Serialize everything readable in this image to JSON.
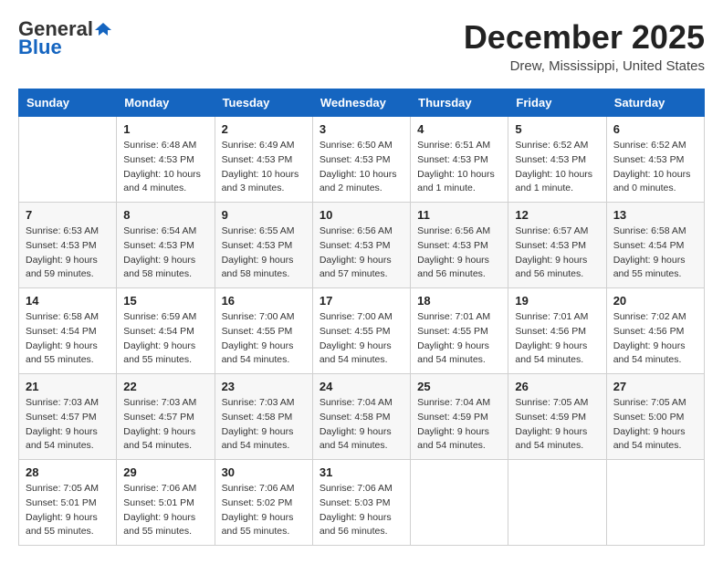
{
  "header": {
    "logo_general": "General",
    "logo_blue": "Blue",
    "month_title": "December 2025",
    "location": "Drew, Mississippi, United States"
  },
  "days_of_week": [
    "Sunday",
    "Monday",
    "Tuesday",
    "Wednesday",
    "Thursday",
    "Friday",
    "Saturday"
  ],
  "weeks": [
    [
      {
        "day": "",
        "content": ""
      },
      {
        "day": "1",
        "content": "Sunrise: 6:48 AM\nSunset: 4:53 PM\nDaylight: 10 hours\nand 4 minutes."
      },
      {
        "day": "2",
        "content": "Sunrise: 6:49 AM\nSunset: 4:53 PM\nDaylight: 10 hours\nand 3 minutes."
      },
      {
        "day": "3",
        "content": "Sunrise: 6:50 AM\nSunset: 4:53 PM\nDaylight: 10 hours\nand 2 minutes."
      },
      {
        "day": "4",
        "content": "Sunrise: 6:51 AM\nSunset: 4:53 PM\nDaylight: 10 hours\nand 1 minute."
      },
      {
        "day": "5",
        "content": "Sunrise: 6:52 AM\nSunset: 4:53 PM\nDaylight: 10 hours\nand 1 minute."
      },
      {
        "day": "6",
        "content": "Sunrise: 6:52 AM\nSunset: 4:53 PM\nDaylight: 10 hours\nand 0 minutes."
      }
    ],
    [
      {
        "day": "7",
        "content": "Sunrise: 6:53 AM\nSunset: 4:53 PM\nDaylight: 9 hours\nand 59 minutes."
      },
      {
        "day": "8",
        "content": "Sunrise: 6:54 AM\nSunset: 4:53 PM\nDaylight: 9 hours\nand 58 minutes."
      },
      {
        "day": "9",
        "content": "Sunrise: 6:55 AM\nSunset: 4:53 PM\nDaylight: 9 hours\nand 58 minutes."
      },
      {
        "day": "10",
        "content": "Sunrise: 6:56 AM\nSunset: 4:53 PM\nDaylight: 9 hours\nand 57 minutes."
      },
      {
        "day": "11",
        "content": "Sunrise: 6:56 AM\nSunset: 4:53 PM\nDaylight: 9 hours\nand 56 minutes."
      },
      {
        "day": "12",
        "content": "Sunrise: 6:57 AM\nSunset: 4:53 PM\nDaylight: 9 hours\nand 56 minutes."
      },
      {
        "day": "13",
        "content": "Sunrise: 6:58 AM\nSunset: 4:54 PM\nDaylight: 9 hours\nand 55 minutes."
      }
    ],
    [
      {
        "day": "14",
        "content": "Sunrise: 6:58 AM\nSunset: 4:54 PM\nDaylight: 9 hours\nand 55 minutes."
      },
      {
        "day": "15",
        "content": "Sunrise: 6:59 AM\nSunset: 4:54 PM\nDaylight: 9 hours\nand 55 minutes."
      },
      {
        "day": "16",
        "content": "Sunrise: 7:00 AM\nSunset: 4:55 PM\nDaylight: 9 hours\nand 54 minutes."
      },
      {
        "day": "17",
        "content": "Sunrise: 7:00 AM\nSunset: 4:55 PM\nDaylight: 9 hours\nand 54 minutes."
      },
      {
        "day": "18",
        "content": "Sunrise: 7:01 AM\nSunset: 4:55 PM\nDaylight: 9 hours\nand 54 minutes."
      },
      {
        "day": "19",
        "content": "Sunrise: 7:01 AM\nSunset: 4:56 PM\nDaylight: 9 hours\nand 54 minutes."
      },
      {
        "day": "20",
        "content": "Sunrise: 7:02 AM\nSunset: 4:56 PM\nDaylight: 9 hours\nand 54 minutes."
      }
    ],
    [
      {
        "day": "21",
        "content": "Sunrise: 7:03 AM\nSunset: 4:57 PM\nDaylight: 9 hours\nand 54 minutes."
      },
      {
        "day": "22",
        "content": "Sunrise: 7:03 AM\nSunset: 4:57 PM\nDaylight: 9 hours\nand 54 minutes."
      },
      {
        "day": "23",
        "content": "Sunrise: 7:03 AM\nSunset: 4:58 PM\nDaylight: 9 hours\nand 54 minutes."
      },
      {
        "day": "24",
        "content": "Sunrise: 7:04 AM\nSunset: 4:58 PM\nDaylight: 9 hours\nand 54 minutes."
      },
      {
        "day": "25",
        "content": "Sunrise: 7:04 AM\nSunset: 4:59 PM\nDaylight: 9 hours\nand 54 minutes."
      },
      {
        "day": "26",
        "content": "Sunrise: 7:05 AM\nSunset: 4:59 PM\nDaylight: 9 hours\nand 54 minutes."
      },
      {
        "day": "27",
        "content": "Sunrise: 7:05 AM\nSunset: 5:00 PM\nDaylight: 9 hours\nand 54 minutes."
      }
    ],
    [
      {
        "day": "28",
        "content": "Sunrise: 7:05 AM\nSunset: 5:01 PM\nDaylight: 9 hours\nand 55 minutes."
      },
      {
        "day": "29",
        "content": "Sunrise: 7:06 AM\nSunset: 5:01 PM\nDaylight: 9 hours\nand 55 minutes."
      },
      {
        "day": "30",
        "content": "Sunrise: 7:06 AM\nSunset: 5:02 PM\nDaylight: 9 hours\nand 55 minutes."
      },
      {
        "day": "31",
        "content": "Sunrise: 7:06 AM\nSunset: 5:03 PM\nDaylight: 9 hours\nand 56 minutes."
      },
      {
        "day": "",
        "content": ""
      },
      {
        "day": "",
        "content": ""
      },
      {
        "day": "",
        "content": ""
      }
    ]
  ]
}
